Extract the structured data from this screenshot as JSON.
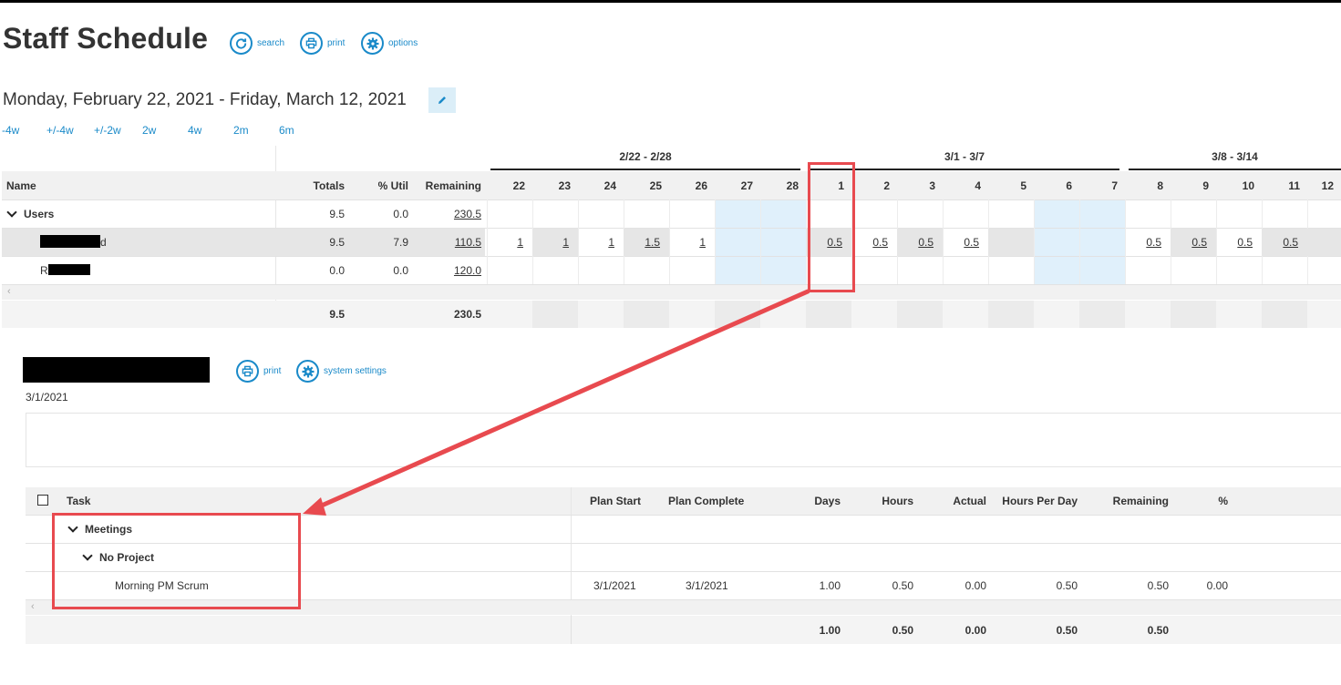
{
  "page": {
    "title": "Staff Schedule",
    "tools": {
      "search": "search",
      "print": "print",
      "options": "options"
    },
    "date_range": "Monday, February 22, 2021 - Friday, March 12, 2021",
    "nav": [
      "-4w",
      "+/-4w",
      "+/-2w",
      "2w",
      "4w",
      "2m",
      "6m"
    ]
  },
  "schedule": {
    "weeks": [
      "2/22 - 2/28",
      "3/1 - 3/7",
      "3/8 - 3/14"
    ],
    "headers": {
      "name": "Name",
      "totals": "Totals",
      "util": "% Util",
      "remaining": "Remaining"
    },
    "days": [
      "22",
      "23",
      "24",
      "25",
      "26",
      "27",
      "28",
      "1",
      "2",
      "3",
      "4",
      "5",
      "6",
      "7",
      "8",
      "9",
      "10",
      "11",
      "12"
    ],
    "group": {
      "label": "Users",
      "totals": "9.5",
      "util": "0.0",
      "remaining": "230.5"
    },
    "rows": [
      {
        "name_suffix": "d",
        "totals": "9.5",
        "util": "7.9",
        "remaining": "110.5",
        "values": [
          "1",
          "1",
          "1",
          "1.5",
          "1",
          "",
          "",
          "0.5",
          "0.5",
          "0.5",
          "0.5",
          "",
          "",
          "",
          "0.5",
          "0.5",
          "0.5",
          "0.5",
          ""
        ]
      },
      {
        "name_prefix": "R",
        "totals": "0.0",
        "util": "0.0",
        "remaining": "120.0",
        "values": [
          "",
          "",
          "",
          "",
          "",
          "",
          "",
          "",
          "",
          "",
          "",
          "",
          "",
          "",
          "",
          "",
          "",
          "",
          ""
        ]
      }
    ],
    "footer": {
      "totals": "9.5",
      "remaining": "230.5"
    }
  },
  "detail": {
    "tools": {
      "print": "print",
      "settings": "system settings"
    },
    "date": "3/1/2021",
    "headers": {
      "task": "Task",
      "plan_start": "Plan Start",
      "plan_complete": "Plan Complete",
      "days": "Days",
      "hours": "Hours",
      "actual": "Actual",
      "hours_per_day": "Hours Per Day",
      "remaining": "Remaining",
      "pct": "%"
    },
    "group1": "Meetings",
    "group2": "No Project",
    "task": {
      "name": "Morning PM Scrum",
      "plan_start": "3/1/2021",
      "plan_complete": "3/1/2021",
      "days": "1.00",
      "hours": "0.50",
      "actual": "0.00",
      "hours_per_day": "0.50",
      "remaining": "0.50",
      "pct": "0.00"
    },
    "footer": {
      "days": "1.00",
      "hours": "0.50",
      "actual": "0.00",
      "hours_per_day": "0.50",
      "remaining": "0.50"
    }
  },
  "colors": {
    "accent": "#1a8ac9",
    "annotation": "#e84a4f",
    "weekend": "#e0f0fb"
  }
}
